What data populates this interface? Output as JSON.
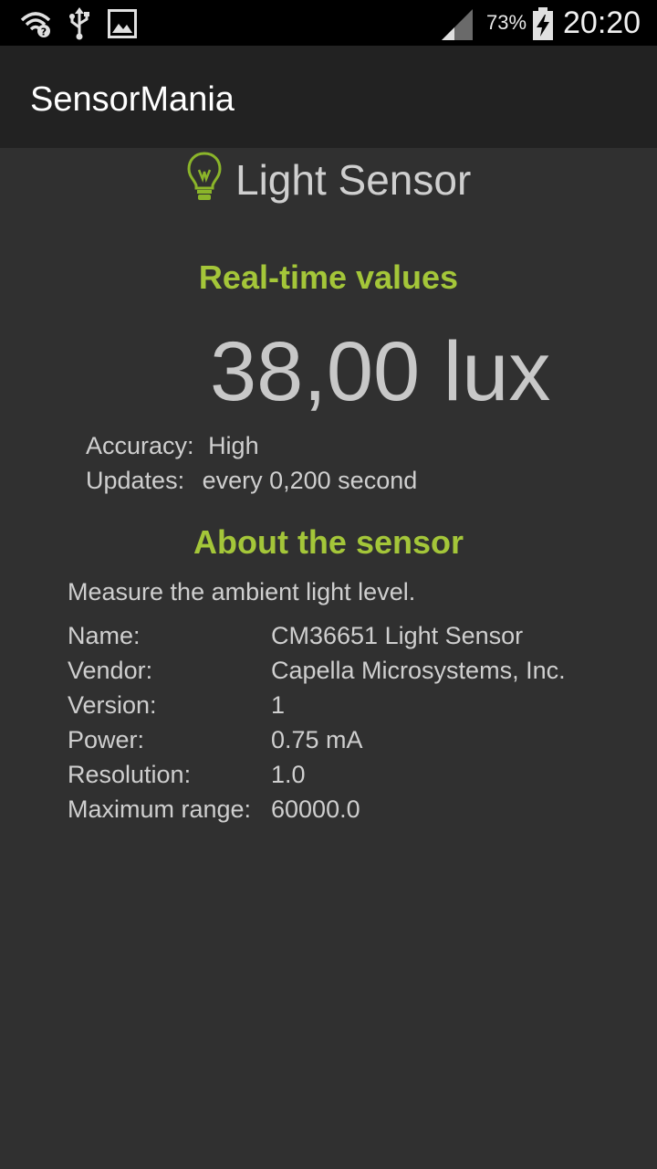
{
  "status_bar": {
    "icons": [
      "wifi-icon",
      "usb-icon",
      "image-icon",
      "signal-icon",
      "battery-charging-icon"
    ],
    "battery_percent": "73%",
    "time": "20:20"
  },
  "app_bar": {
    "title": "SensorMania"
  },
  "sensor": {
    "icon": "lightbulb-icon",
    "title": "Light Sensor"
  },
  "realtime": {
    "heading": "Real-time values",
    "value": "38,00 lux",
    "accuracy_label": "Accuracy:",
    "accuracy_value": "High",
    "updates_label": "Updates:",
    "updates_value": "every 0,200 second"
  },
  "about": {
    "heading": "About the sensor",
    "description": "Measure the ambient light level.",
    "rows": [
      {
        "key": "Name:",
        "value": "CM36651 Light Sensor"
      },
      {
        "key": "Vendor:",
        "value": "Capella Microsystems, Inc."
      },
      {
        "key": "Version:",
        "value": "1"
      },
      {
        "key": "Power:",
        "value": "0.75 mA"
      },
      {
        "key": "Resolution:",
        "value": "1.0"
      },
      {
        "key": "Maximum range:",
        "value": "60000.0"
      }
    ]
  },
  "colors": {
    "accent": "#a4c639",
    "background": "#303030",
    "app_bar": "#222222",
    "status_bar": "#000000"
  }
}
